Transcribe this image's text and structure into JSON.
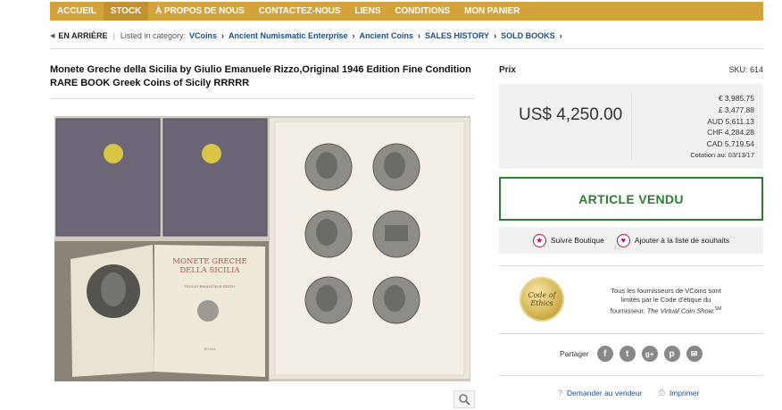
{
  "nav": {
    "items": [
      {
        "label": "ACCUEIL",
        "active": false
      },
      {
        "label": "STOCK",
        "active": true
      },
      {
        "label": "À PROPOS DE NOUS",
        "active": false
      },
      {
        "label": "CONTACTEZ-NOUS",
        "active": false
      },
      {
        "label": "LIENS",
        "active": false
      },
      {
        "label": "CONDITIONS",
        "active": false
      },
      {
        "label": "MON PANIER",
        "active": false
      }
    ]
  },
  "breadcrumb": {
    "back": "EN ARRIÈRE",
    "listed_label": "Listed in category:",
    "links": [
      "VCoins",
      "Ancient Numismatic Enterprise",
      "Ancient Coins",
      "SALES HISTORY",
      "SOLD BOOKS"
    ]
  },
  "product": {
    "title": "Monete Greche della Sicilia by Giulio Emanuele Rizzo,Original 1946 Edition Fine Condition RARE BOOK Greek Coins of Sicily RRRRR",
    "book_title_line1": "MONETE GRECHE",
    "book_title_line2": "DELLA SICILIA",
    "book_author": "GIULIO EMANUELE RIZZO",
    "book_city": "ROMA"
  },
  "pricing": {
    "label": "Prix",
    "sku": "SKU: 614",
    "main": "US$ 4,250.00",
    "conversions": [
      "€ 3,985.75",
      "£ 3,477.88",
      "AUD 5,611.13",
      "CHF 4,284.28",
      "CAD 5,719.54"
    ],
    "quote_date": "Cotation au: 03/13/17"
  },
  "status": {
    "sold_label": "ARTICLE VENDU"
  },
  "actions": {
    "follow": "Suivre Boutique",
    "wishlist": "Ajouter à la liste de souhaits"
  },
  "ethics": {
    "badge_line1": "Code of",
    "badge_line2": "Ethics",
    "text_line1": "Tous les fournisseurs de VCoins sont",
    "text_line2": "limités par le Code d'étique du",
    "text_line3": "fournisseur.",
    "text_show": "The Virtual Coin Show.",
    "text_sm": "SM"
  },
  "share": {
    "label": "Partager",
    "icons": [
      "f",
      "t",
      "g+",
      "p",
      "✉"
    ]
  },
  "links": {
    "ask": "Demander au vendeur",
    "print": "Imprimer"
  },
  "colors": {
    "nav_bg": "#d3a23a",
    "sold_green": "#2f7d32",
    "link_blue": "#1d4e89",
    "heart_pink": "#b0144b"
  }
}
